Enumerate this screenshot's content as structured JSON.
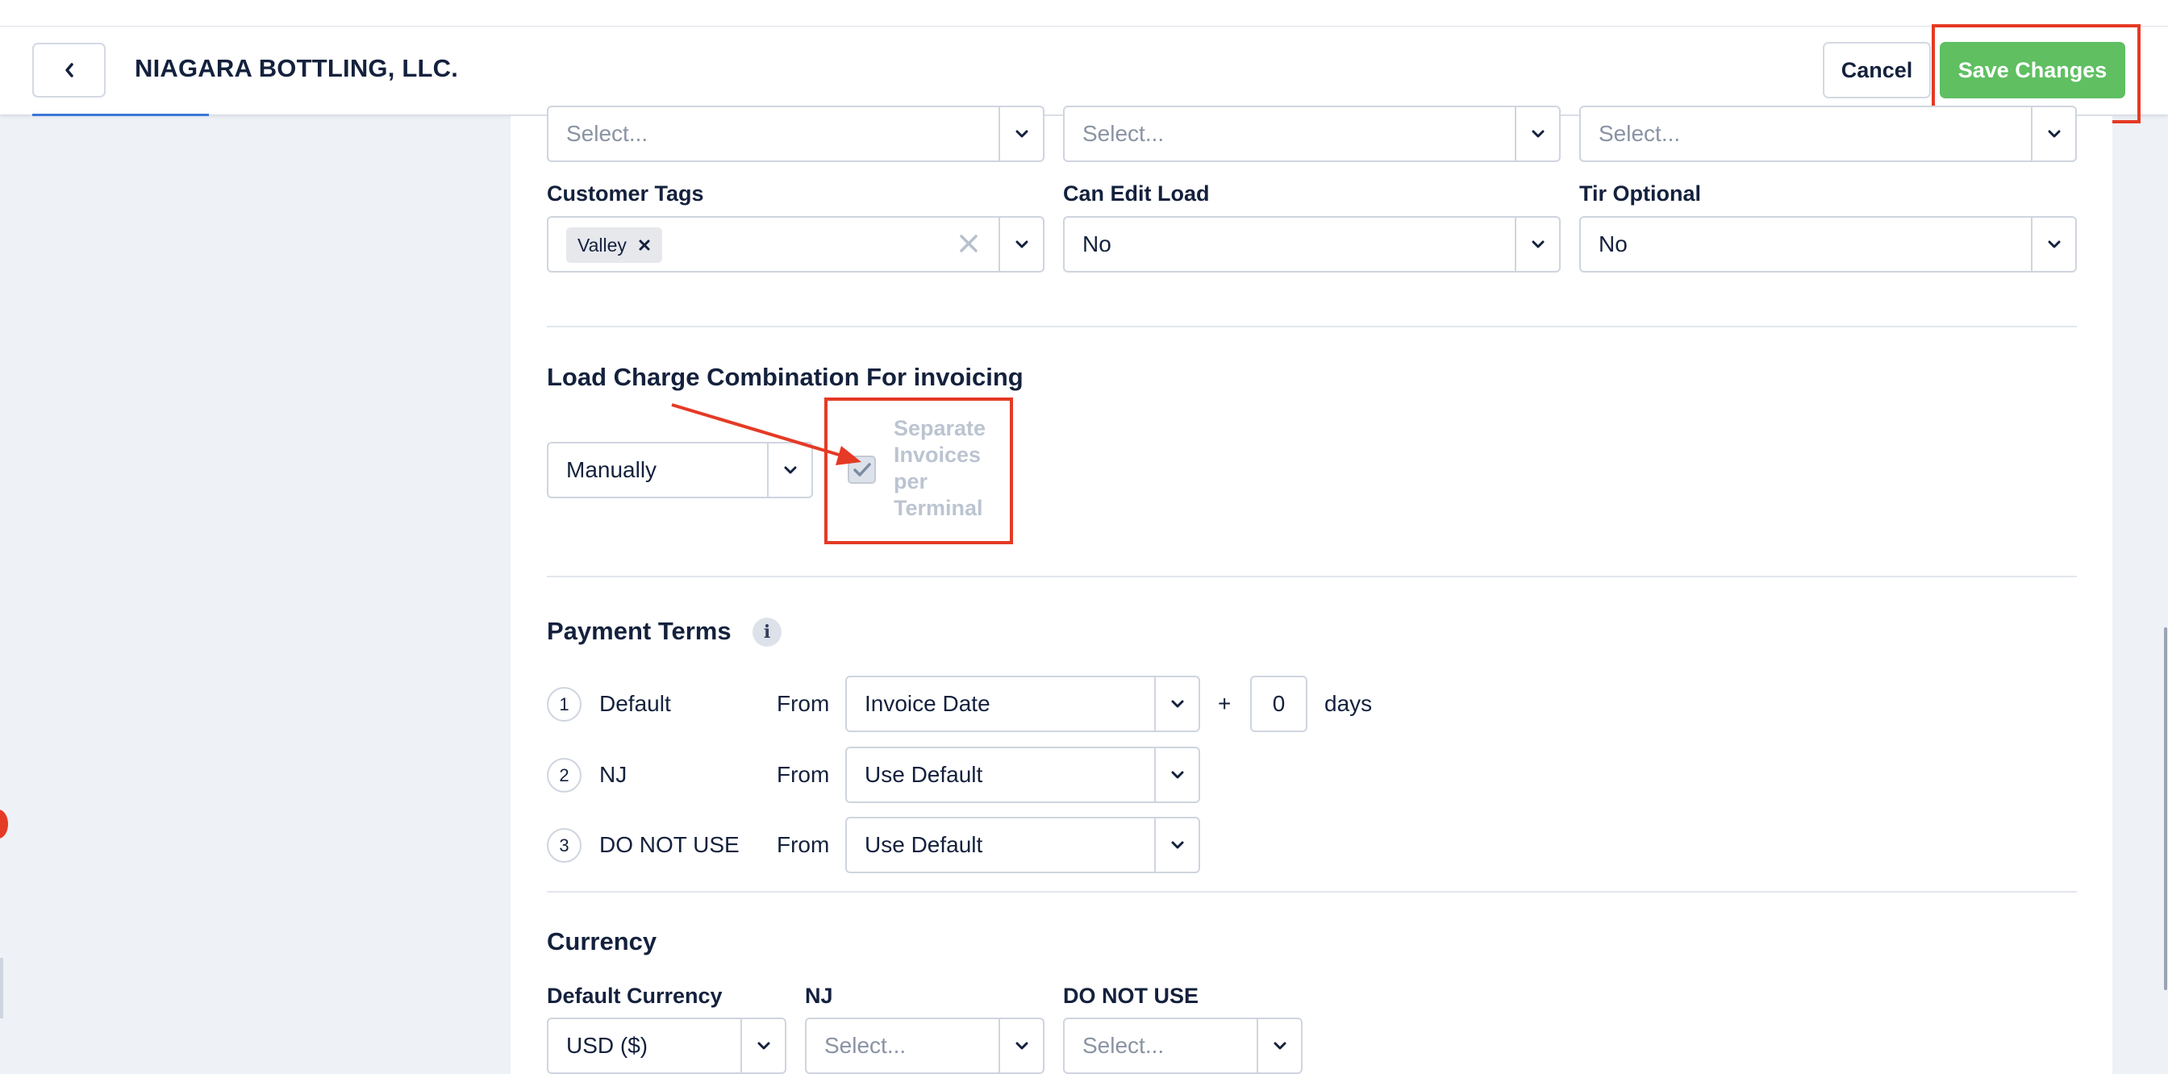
{
  "header": {
    "title": "NIAGARA BOTTLING, LLC.",
    "back_icon": "chevron-left-icon",
    "cancel_label": "Cancel",
    "save_label": "Save Changes",
    "save_color": "#5fbf61",
    "annotation_color": "#e53a25"
  },
  "top_selects": [
    {
      "placeholder": "Select..."
    },
    {
      "placeholder": "Select..."
    },
    {
      "placeholder": "Select..."
    }
  ],
  "fields": {
    "customer_tags": {
      "label": "Customer Tags",
      "tags": [
        "Valley"
      ]
    },
    "can_edit_load": {
      "label": "Can Edit Load",
      "value": "No"
    },
    "tir_optional": {
      "label": "Tir Optional",
      "value": "No"
    }
  },
  "load_charge": {
    "title": "Load Charge Combination For invoicing",
    "mode": "Manually",
    "separate_invoices_label": "Separate Invoices per Terminal",
    "separate_invoices_checked": true,
    "separate_invoices_disabled": true
  },
  "payment_terms": {
    "title": "Payment Terms",
    "info_icon": "i",
    "rows": [
      {
        "num": "1",
        "name": "Default",
        "from_label": "From",
        "value": "Invoice Date",
        "plus": "+",
        "days_value": "0",
        "days_label": "days"
      },
      {
        "num": "2",
        "name": "NJ",
        "from_label": "From",
        "value": "Use Default"
      },
      {
        "num": "3",
        "name": "DO NOT USE",
        "from_label": "From",
        "value": "Use Default"
      }
    ]
  },
  "currency": {
    "title": "Currency",
    "columns": [
      {
        "label": "Default Currency",
        "value": "USD ($)"
      },
      {
        "label": "NJ",
        "placeholder": "Select..."
      },
      {
        "label": "DO NOT USE",
        "placeholder": "Select..."
      }
    ]
  }
}
